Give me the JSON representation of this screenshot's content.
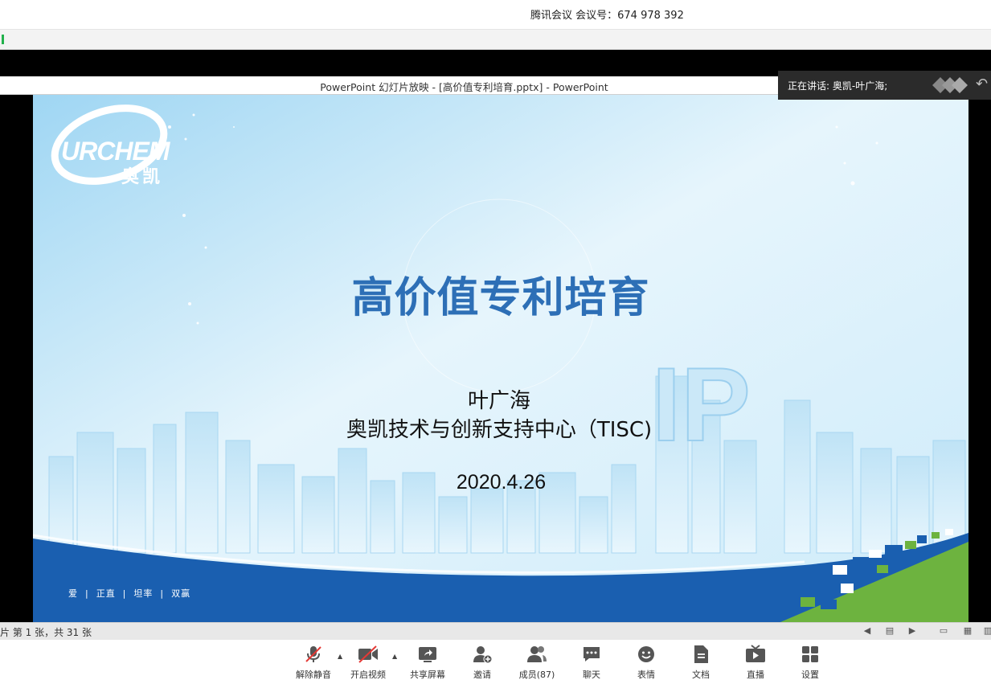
{
  "window": {
    "title": "腾讯会议 会议号：674 978 392"
  },
  "presentation": {
    "window_title": "PowerPoint 幻灯片放映 - [高价值专利培育.pptx] - PowerPoint",
    "slide": {
      "logo_text": "URCHEM",
      "logo_cn": "奥凯",
      "title": "高价值专利培育",
      "author": "叶广海",
      "organization": "奥凯技术与创新支持中心（TISC)",
      "date": "2020.4.26",
      "motto": "爱  |  正直  |  坦率  |  双赢"
    },
    "status": "片 第 1 张，共 31 张"
  },
  "speaking": {
    "label": "正在讲话: 奥凯-叶广海;"
  },
  "toolbar": {
    "unmute": "解除静音",
    "video": "开启视频",
    "share": "共享屏幕",
    "invite": "邀请",
    "members": "成员(87)",
    "chat": "聊天",
    "emoji": "表情",
    "docs": "文档",
    "live": "直播",
    "settings": "设置"
  },
  "colors": {
    "title_blue": "#2d6fb6",
    "wave_blue": "#1a5fb0",
    "accent_green": "#6db33f"
  }
}
